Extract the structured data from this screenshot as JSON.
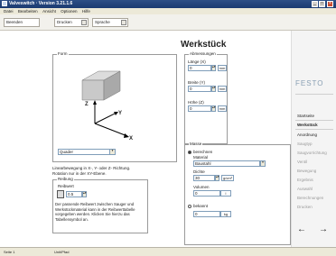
{
  "window": {
    "title": "Valveswitch · Version 3.21.1.6",
    "minimize": "_",
    "maximize": "□",
    "close": "×"
  },
  "menu": [
    "Datei",
    "Bearbeiten",
    "Ansicht",
    "Optionen",
    "Hilfe"
  ],
  "toolbar": {
    "print": "Drucken",
    "language": "Sprache",
    "first": "Beenden"
  },
  "page": {
    "title": "Werkstück"
  },
  "shape": {
    "group_label": "Form",
    "axes": {
      "x": "X",
      "y": "Y",
      "z": "Z"
    },
    "select_value": "Quader"
  },
  "dimensions": {
    "group_label": "Abmessungen",
    "length_label": "Länge (X)",
    "length_value": "0",
    "length_unit": "mm",
    "width_label": "Breite (Y)",
    "width_value": "0",
    "width_unit": "mm",
    "height_label": "Höhe (Z)",
    "height_value": "0",
    "height_unit": "mm"
  },
  "note": {
    "text1": "Linearbewegung in X-, Y- oder Z- Richtung.",
    "text2": "Rotation nur in der XY-Ebene."
  },
  "friction": {
    "group_label": "Reibung",
    "value_label": "Reibwert",
    "value": "0.5",
    "desc": "Der passende Reibwert zwischen Sauger und Werkstückmaterial kann in der Reibwerttabelle vorgegeben werden. Klicken Sie hierzu das Tabellensymbol an."
  },
  "mass": {
    "group_label": "Masse",
    "option_calc": "berechnen",
    "material_label": "Material",
    "material_value": "Baustahl",
    "density_label": "Dichte",
    "density_value": "30",
    "density_unit": "g/cm³",
    "volume_label": "Volumen",
    "volume_value": "0",
    "volume_unit": "l",
    "option_known": "bekannt",
    "known_value": "0",
    "known_unit": "kg"
  },
  "sidebar": {
    "logo": "FESTO",
    "items": [
      "Startseite",
      "Werkstück",
      "Anordnung",
      "Saugtyp",
      "Saugvorrichtung",
      "Ventil",
      "Bewegung",
      "Ergebnis",
      "Auswahl",
      "Berechnungen",
      "Drucken"
    ],
    "back": "←",
    "forward": "→"
  },
  "status": {
    "left": "Seite 1",
    "mid": "Unit/Pfad"
  },
  "colors": {
    "titlebar": "#1a3a70",
    "accent": "#8aa0b4"
  }
}
